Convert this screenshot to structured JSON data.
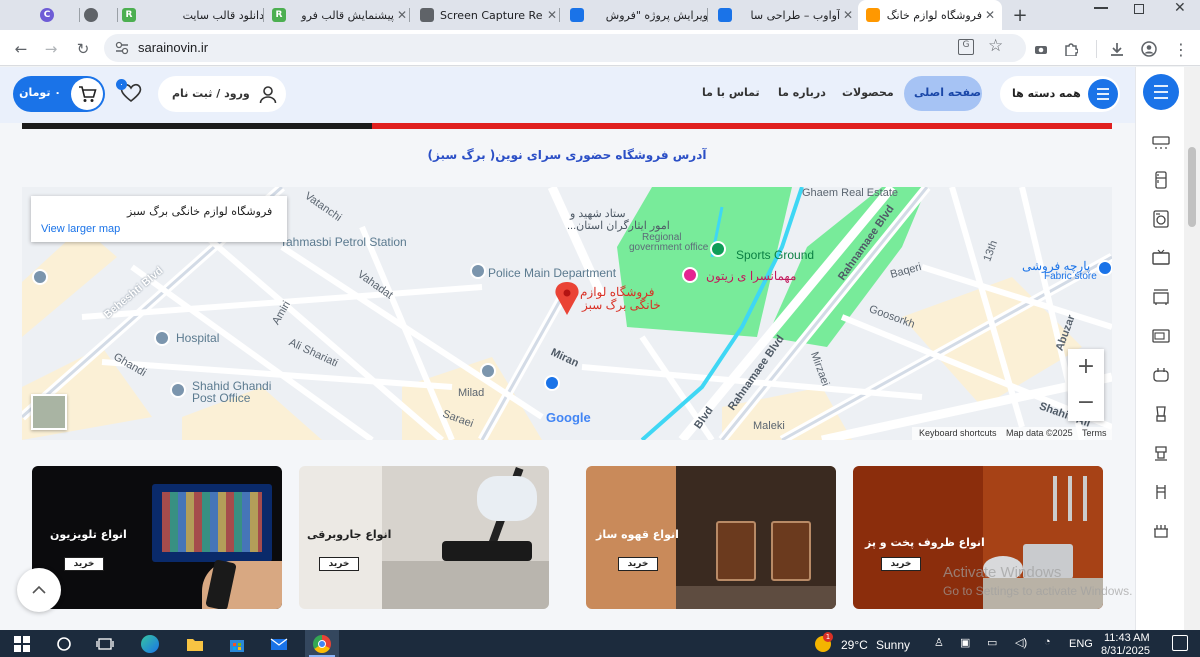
{
  "browser": {
    "tabs": [
      {
        "title": "",
        "favicon": "chrome-c-icon",
        "color": "#6e5cd6"
      },
      {
        "title": "",
        "favicon": "globe-icon",
        "color": "#5f6368"
      },
      {
        "title": "دانلود قالب سایت",
        "favicon": "rtl-theme-icon",
        "color": "#4caf50"
      },
      {
        "title": "پیشنمایش قالب فرو",
        "favicon": "rtl-theme-icon",
        "color": "#4caf50"
      },
      {
        "title": "Screen Capture Re",
        "favicon": "camera-icon",
        "color": "#5f6368"
      },
      {
        "title": "ویرایش پروژه \"فروش",
        "favicon": "app-icon",
        "color": "#1a73e8"
      },
      {
        "title": "آواوب – طراحی سا",
        "favicon": "app-icon",
        "color": "#1a73e8"
      },
      {
        "title": "فروشگاه لوازم خانگ",
        "favicon": "home-icon",
        "color": "#ff9800"
      }
    ],
    "new_tab": "+",
    "url": "sarainovin.ir"
  },
  "header": {
    "all_categories": "همه دسته ها",
    "nav": [
      "صفحه اصلی",
      "محصولات",
      "درباره ما",
      "تماس با ما"
    ],
    "login": "ورود / ثبت نام",
    "cart_label": "۰ تومان",
    "cart_count": "۰",
    "wish_count": "۰"
  },
  "main": {
    "address_title": "آدرس فروشگاه حضوری سرای نوین( برگ سبز)",
    "map": {
      "info_title": "فروشگاه لوازم خانگی برگ سبز",
      "view_larger": "View larger map",
      "pin_label_line1": "فروشگاه لوازم",
      "pin_label_line2": "خانگی برگ سبز",
      "labels": {
        "vatanchi": "Vatanchi",
        "petrol": "Tahmasbi Petrol Station",
        "beheshti": "Beheshti Blvd",
        "vahadat": "Vahadat",
        "amiri": "Amiri",
        "ali_shariati": "Ali Shariati",
        "hospital": "Hospital",
        "ghandi": "Ghandi",
        "post_office_1": "Shahid Ghandi",
        "post_office_2": "Post Office",
        "police": "Police Main Department",
        "milad": "Milad",
        "saraei": "Saraei",
        "miran": "Miran",
        "gov_1": "ستاد شهید و",
        "gov_2": "امور ایثارگران استان...",
        "gov_3": "Regional",
        "gov_4": "government office",
        "sports": "Sports Ground",
        "guest": "مهمانسرا ی زیتون",
        "rahnamaee_1": "Rahnamaee Blvd",
        "rahnamaee_2": "Rahnamaee Blvd",
        "blvd": "Blvd",
        "ghaem": "Ghaem Real Estate",
        "baqeri": "Baqeri",
        "goosorkh": "Goosorkh",
        "mirzaei": "Mirzaei",
        "thirteenth": "13th",
        "abuzar": "Abuzar",
        "shahid_ali": "Shahid Ali",
        "maleki": "Maleki",
        "fabric_fa": "پارچه فروشی",
        "fabric_en": "Fabric store",
        "google": "Google",
        "shortcuts": "Keyboard shortcuts",
        "mapdata": "Map data ©2025",
        "terms": "Terms",
        "zoom_in": "+",
        "zoom_out": "−"
      }
    },
    "cards": [
      {
        "title": "انواع تلویزیون",
        "buy": "خرید"
      },
      {
        "title": "انواع جاروبرقی",
        "buy": "خرید"
      },
      {
        "title": "انواع قهوه ساز",
        "buy": "خرید"
      },
      {
        "title": "انواع ظروف پخت و پز",
        "buy": "خرید"
      }
    ],
    "watermark_1": "Activate Windows",
    "watermark_2": "Go to Settings to activate Windows."
  },
  "taskbar": {
    "weather_temp": "29°C",
    "weather_text": "Sunny",
    "weather_badge": "1",
    "lang": "ENG",
    "time": "11:43 AM",
    "date": "8/31/2025"
  }
}
